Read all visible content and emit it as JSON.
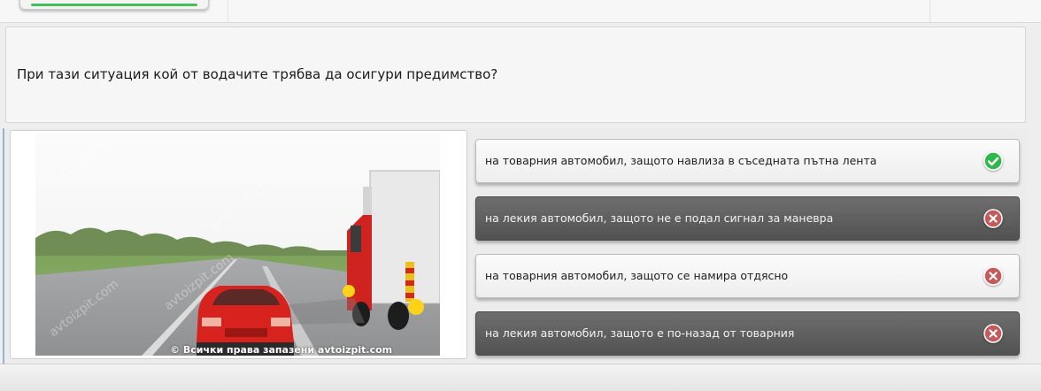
{
  "question": {
    "text": "При тази ситуация кой от водачите трябва да осигури предимство?"
  },
  "image": {
    "watermark": "© Всички права запазени avtoizpit.com",
    "diagonal_watermark": "avtoizpit.com"
  },
  "answers": [
    {
      "label": "на товарния автомобил, защото навлиза в съседната пътна лента",
      "status": "correct",
      "style": "light"
    },
    {
      "label": "на лекия автомобил, защото не е подал сигнал за маневра",
      "status": "wrong",
      "style": "dark"
    },
    {
      "label": "на товарния автомобил, защото се намира отдясно",
      "status": "wrong",
      "style": "light"
    },
    {
      "label": "на лекия автомобил, защото е по-назад от товарния",
      "status": "wrong",
      "style": "dark"
    }
  ],
  "colors": {
    "correct": "#2fb84a",
    "wrong": "#c45a5a",
    "progress": "#44c05a"
  },
  "icons": {
    "correct": "check-circle-icon",
    "wrong": "x-circle-icon"
  }
}
